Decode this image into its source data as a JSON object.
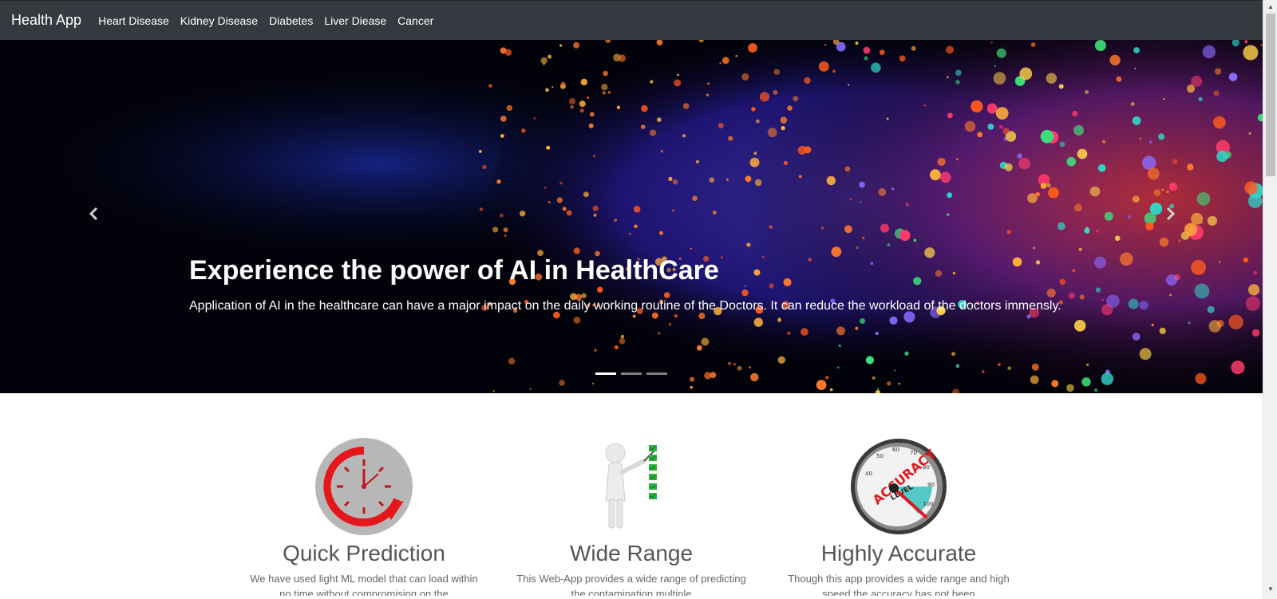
{
  "navbar": {
    "brand": "Health App",
    "links": [
      "Heart Disease",
      "Kidney Disease",
      "Diabetes",
      "Liver Diease",
      "Cancer"
    ]
  },
  "carousel": {
    "title": "Experience the power of AI in HealthCare",
    "text": "Application of AI in the healthcare can have a major impact on the daily working routine of the Doctors. It can reduce the workload of the doctors immensly.",
    "indicators": 3,
    "active_indicator": 0,
    "prev_icon": "chevron-left-icon",
    "next_icon": "chevron-right-icon"
  },
  "features": [
    {
      "icon": "clock-icon",
      "title": "Quick Prediction",
      "text": "We have used light ML model that can load within no time without compromising on the"
    },
    {
      "icon": "presenter-checklist-icon",
      "title": "Wide Range",
      "text": "This Web-App provides a wide range of predicting the contamination multiple"
    },
    {
      "icon": "accuracy-gauge-icon",
      "title": "Highly Accurate",
      "text": "Though this app provides a wide range and high speed the accuracy has not been"
    }
  ],
  "gauge": {
    "label_top": "ACCURACY",
    "label_bottom": "LEVEL",
    "ticks": [
      "40",
      "50",
      "60",
      "70",
      "80",
      "90",
      "100"
    ]
  },
  "colors": {
    "navbar": "#343a40",
    "accent_red": "#e4171d",
    "bottom_strip": "#1d7a78"
  }
}
